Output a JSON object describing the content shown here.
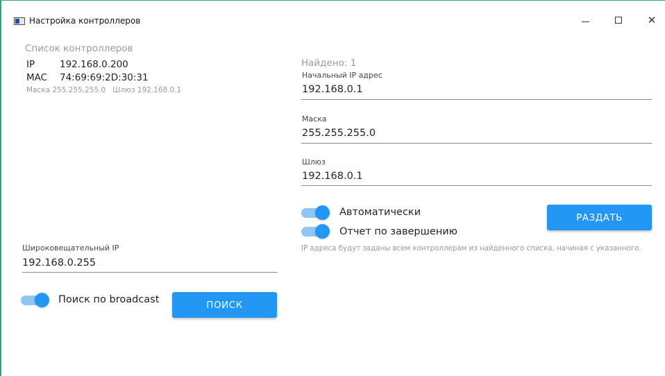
{
  "window": {
    "title": "Настройка контроллеров",
    "accent": "#2aa876"
  },
  "controllers": {
    "heading": "Список контроллеров",
    "items": [
      {
        "ip_label": "IP",
        "ip": "192.168.0.200",
        "mac_label": "MAC",
        "mac": "74:69:69:2D:30:31",
        "details": "Маска 255.255.255.0   Шлюз 192.168.0.1"
      }
    ]
  },
  "search": {
    "broadcast_label": "Широковещательный IP",
    "broadcast_ip": "192.168.0.255",
    "toggle_label": "Поиск по broadcast",
    "toggle_on": true,
    "button_label": "ПОИСК"
  },
  "assign": {
    "found": "Найдено: 1",
    "start_ip_label": "Начальный IP адрес",
    "start_ip": "192.168.0.1",
    "mask_label": "Маска",
    "mask": "255.255.255.0",
    "gateway_label": "Шлюз",
    "gateway": "192.168.0.1",
    "auto_label": "Автоматически",
    "auto_on": true,
    "report_label": "Отчет по завершению",
    "report_on": true,
    "button_label": "РАЗДАТЬ",
    "hint": "IP адреса будут заданы всем контроллерам из найденного списка, начиная с указанного."
  },
  "colors": {
    "primary": "#2196f3",
    "toggle_track": "#90c6f2"
  }
}
